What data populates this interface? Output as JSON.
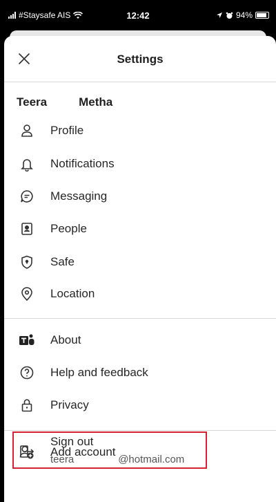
{
  "status_bar": {
    "carrier": "#Staysafe AIS",
    "time": "12:42",
    "battery": "94%"
  },
  "header": {
    "title": "Settings",
    "close_icon": "close-icon"
  },
  "user": {
    "first_name": "Teera",
    "last_name": "Metha"
  },
  "menu_group_1": [
    {
      "label": "Profile",
      "icon": "person-icon"
    },
    {
      "label": "Notifications",
      "icon": "bell-icon"
    },
    {
      "label": "Messaging",
      "icon": "chat-bubble-icon"
    },
    {
      "label": "People",
      "icon": "contacts-icon"
    },
    {
      "label": "Safe",
      "icon": "shield-icon"
    },
    {
      "label": "Location",
      "icon": "location-pin-icon"
    }
  ],
  "menu_group_2": [
    {
      "label": "About",
      "icon": "teams-logo-icon"
    },
    {
      "label": "Help and feedback",
      "icon": "question-circle-icon"
    },
    {
      "label": "Privacy",
      "icon": "lock-icon"
    }
  ],
  "menu_group_3": [
    {
      "label": "Add account",
      "icon": "add-person-icon"
    }
  ],
  "sign_out": {
    "label": "Sign out",
    "email_user": "teera",
    "email_domain": "@hotmail.com",
    "icon": "sign-out-icon",
    "highlight_color": "#d52132"
  }
}
